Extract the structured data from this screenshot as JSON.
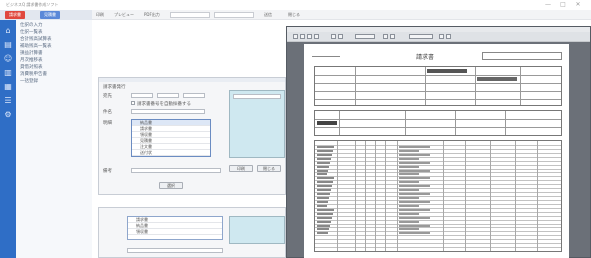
{
  "window": {
    "title": "ビジネスQ 請求書作成ソフト",
    "controls": [
      "—",
      "□",
      "✕"
    ]
  },
  "nav": {
    "tabs": [
      "請求書",
      "見積書"
    ],
    "links": [
      "仕訳の入力",
      "仕訳一覧表",
      "合計残高試算表",
      "補助残高一覧表",
      "損益計算書",
      "月次推移表",
      "貸借対照表",
      "消費税申告書",
      "一括登録"
    ],
    "icons": [
      "home-icon",
      "document-icon",
      "person-icon",
      "chart-icon",
      "calculator-icon",
      "list-icon",
      "gear-icon"
    ],
    "colors": {
      "rail": "#2f6ec6",
      "tab_active": "#e0483e",
      "tab_inactive": "#5a88d8"
    }
  },
  "toolbar": {
    "items": [
      "印刷",
      "プレビュー",
      "PDF出力",
      "送信",
      "閉じる"
    ]
  },
  "form": {
    "title": "請求書発行",
    "labels": [
      "宛先",
      "件名",
      "請求日",
      "担当者",
      "備考",
      "明細"
    ],
    "option_text": "請求書番号を自動採番する",
    "list_items": [
      "納品書",
      "請求書",
      "領収書",
      "見積書",
      "注文書",
      "送付状"
    ],
    "buttons": [
      "選択",
      "印刷",
      "閉じる"
    ]
  },
  "form2": {
    "list_items": [
      "請求書",
      "納品書",
      "領収書"
    ]
  },
  "preview": {
    "doc_title": "請求書",
    "rows": 28
  }
}
